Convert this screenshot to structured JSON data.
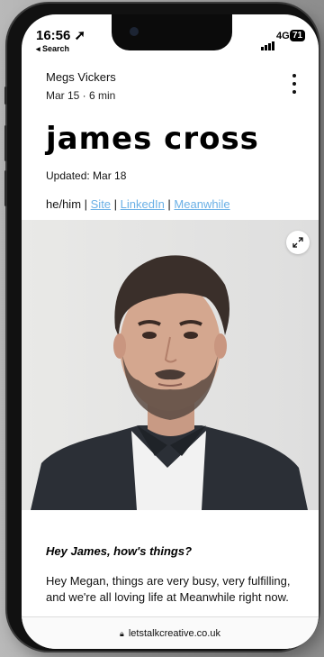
{
  "status_bar": {
    "time": "16:56 ➚",
    "back_label": "◂ Search",
    "network": "4G",
    "battery": "71"
  },
  "post": {
    "author": "Megs Vickers",
    "meta": "Mar 15  ·  6 min",
    "title": "james cross",
    "updated": "Updated: Mar 18",
    "pronouns": "he/him",
    "sep1": " | ",
    "site_link": "Site",
    "sep2": " | ",
    "linkedin_link": "LinkedIn",
    "sep3": " | ",
    "company_link": "Meanwhile",
    "question": "Hey James, how's things?",
    "answer": "Hey Megan, things are very busy, very fulfilling, and we're all loving life at Meanwhile right now."
  },
  "browser": {
    "url": "letstalkcreative.co.uk"
  },
  "colors": {
    "link": "#6ab0e6",
    "phone_frame": "#111111"
  }
}
